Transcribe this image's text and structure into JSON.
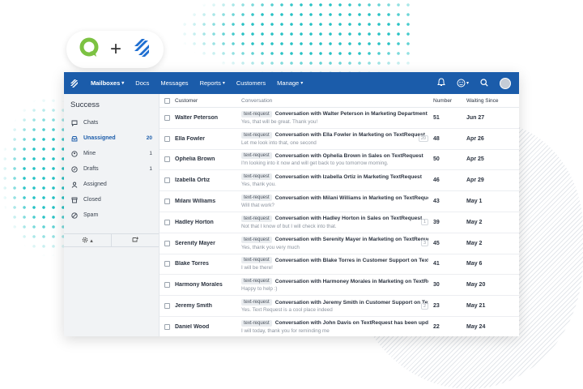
{
  "logos": {
    "left": "textrequest-q-logo",
    "plus": "+",
    "right": "helpscout-logo"
  },
  "nav": {
    "items": [
      {
        "label": "Mailboxes",
        "caret": "▾",
        "active": true
      },
      {
        "label": "Docs"
      },
      {
        "label": "Messages"
      },
      {
        "label": "Reports",
        "caret": "▾"
      },
      {
        "label": "Customers"
      },
      {
        "label": "Manage",
        "caret": "▾"
      }
    ],
    "icons": [
      "bell-icon",
      "smiley-icon",
      "search-icon",
      "avatar"
    ]
  },
  "sidebar": {
    "title": "Success",
    "items": [
      {
        "label": "Chats",
        "count": "",
        "icon": "chat-bubble-icon"
      },
      {
        "label": "Unassigned",
        "count": "20",
        "icon": "inbox-icon",
        "active": true
      },
      {
        "label": "Mine",
        "count": "1",
        "icon": "user-icon"
      },
      {
        "label": "Drafts",
        "count": "1",
        "icon": "draft-icon"
      },
      {
        "label": "Assigned",
        "count": "",
        "icon": "assigned-icon"
      },
      {
        "label": "Closed",
        "count": "",
        "icon": "archive-icon"
      },
      {
        "label": "Spam",
        "count": "",
        "icon": "spam-icon"
      }
    ],
    "bottom": {
      "settings_caret": "▴"
    }
  },
  "list": {
    "headers": {
      "customer": "Customer",
      "conversation": "Conversation",
      "number": "Number",
      "waiting": "Waiting Since"
    },
    "rows": [
      {
        "customer": "Walter Peterson",
        "tag": "text-request",
        "subject": "Conversation with Walter Peterson in Marketing Department",
        "preview": "Yes, that will be great. Thank you!",
        "badge": "",
        "number": "51",
        "waiting": "Jun 27"
      },
      {
        "customer": "Ella Fowler",
        "tag": "text-request",
        "subject": "Conversation with Ella Fowler in Marketing on TextRequest",
        "preview": "Let me look into that, one second",
        "badge": "20",
        "number": "48",
        "waiting": "Apr 26"
      },
      {
        "customer": "Ophelia Brown",
        "tag": "text-request",
        "subject": "Conversation with Ophelia Brown in Sales on TextRequest",
        "preview": "I'm looking into it now and will get back to you tomorrow morning.",
        "badge": "",
        "number": "50",
        "waiting": "Apr 25"
      },
      {
        "customer": "Izabella Ortiz",
        "tag": "text-request",
        "subject": "Conversation with Izabella Ortiz in Marketing TextRequest",
        "preview": "Yes, thank you.",
        "badge": "",
        "number": "46",
        "waiting": "Apr 29"
      },
      {
        "customer": "Milani Williams",
        "tag": "text-request",
        "subject": "Conversation with Milani Williams in Marketing on TextRequest",
        "preview": "Will that work?",
        "badge": "",
        "number": "43",
        "waiting": "May 1"
      },
      {
        "customer": "Hadley Horton",
        "tag": "text-request",
        "subject": "Conversation with Hadley Horton in Sales on TextRequest",
        "preview": "Not that I know of but I will check into that.",
        "badge": "1",
        "number": "39",
        "waiting": "May 2"
      },
      {
        "customer": "Serenity Mayer",
        "tag": "text-request",
        "subject": "Conversation with Serenity Mayer in Marketing on TextRequest",
        "preview": "Yes, thank you very much",
        "badge": "3",
        "number": "45",
        "waiting": "May 2"
      },
      {
        "customer": "Blake Torres",
        "tag": "text-request",
        "subject": "Conversation with Blake Torres in Customer Support on TextRequest",
        "preview": "I will be there!",
        "badge": "",
        "number": "41",
        "waiting": "May 6"
      },
      {
        "customer": "Harmony Morales",
        "tag": "text-request",
        "subject": "Conversation with Harmoney Morales in Marketing on TextRequest",
        "preview": "Happy to help :)",
        "badge": "",
        "number": "30",
        "waiting": "May 20"
      },
      {
        "customer": "Jeremy Smith",
        "tag": "text-request",
        "subject": "Conversation with Jeremy Smith in Customer Support on TextRequest",
        "preview": "Yes. Text Request is a cool place indeed",
        "badge": "2",
        "number": "23",
        "waiting": "May 21"
      },
      {
        "customer": "Daniel Wood",
        "tag": "text-request",
        "subject": "Conversation with John Davis on TextRequest has been updated",
        "preview": "I will today, thank you for reminding me",
        "badge": "",
        "number": "22",
        "waiting": "May 24"
      }
    ]
  },
  "colors": {
    "nav_bg": "#1b5caa",
    "accent": "#1b5caa",
    "dots": "#27c2c4",
    "logo_green": "#7cc242",
    "logo_blue": "#1f6fd1"
  }
}
